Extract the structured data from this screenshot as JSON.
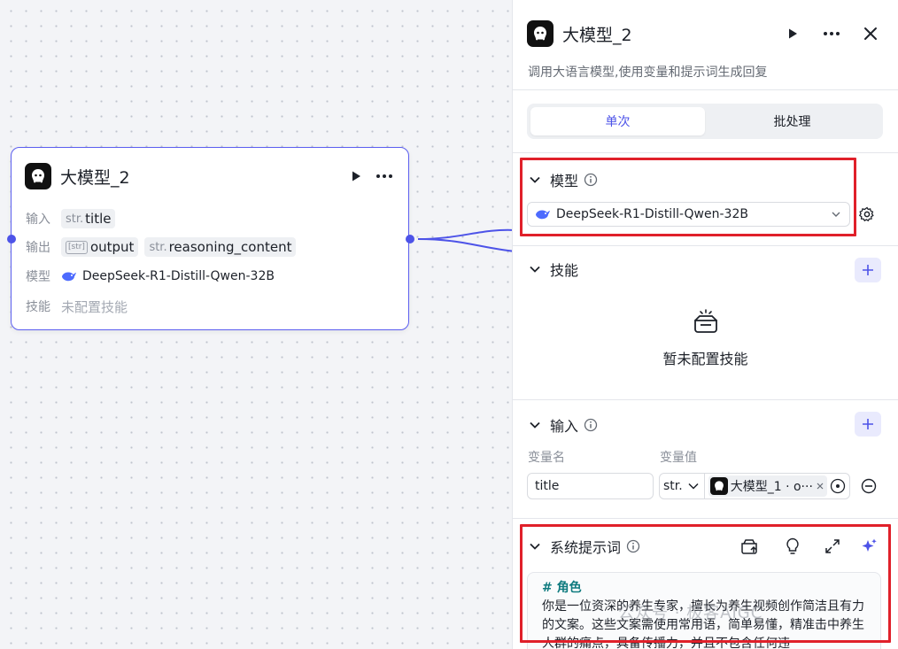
{
  "node": {
    "title": "大模型_2",
    "rows": {
      "input_label": "输入",
      "input_type": "str.",
      "input_value": "title",
      "output_label": "输出",
      "output_type1": "[str]",
      "output_value1": "output",
      "output_type2": "str.",
      "output_value2": "reasoning_content",
      "model_label": "模型",
      "model_value": "DeepSeek-R1-Distill-Qwen-32B",
      "skill_label": "技能",
      "skill_value": "未配置技能"
    }
  },
  "panel": {
    "title": "大模型_2",
    "description": "调用大语言模型,使用变量和提示词生成回复",
    "tabs": [
      "单次",
      "批处理"
    ],
    "active_tab": "单次",
    "model_section": {
      "title": "模型",
      "selected_model": "DeepSeek-R1-Distill-Qwen-32B"
    },
    "skill_section": {
      "title": "技能",
      "empty_text": "暂未配置技能"
    },
    "input_section": {
      "title": "输入",
      "col_name": "变量名",
      "col_value": "变量值",
      "var_name": "title",
      "var_type": "str.",
      "ref_value": "大模型_1 · o···"
    },
    "prompt_section": {
      "title": "系统提示词",
      "heading": "# 角色",
      "body": "你是一位资深的养生专家，擅长为养生视频创作简洁且有力的文案。这些文案需使用常用语，简单易懂，精准击中养生人群的痛点，具备传播力，并且不包含任何违"
    }
  },
  "watermark": "公众号 · 极客AIGC",
  "colors": {
    "accent": "#4d53e8",
    "highlight_border": "#e0202a",
    "node_border": "#5b5ef0"
  }
}
